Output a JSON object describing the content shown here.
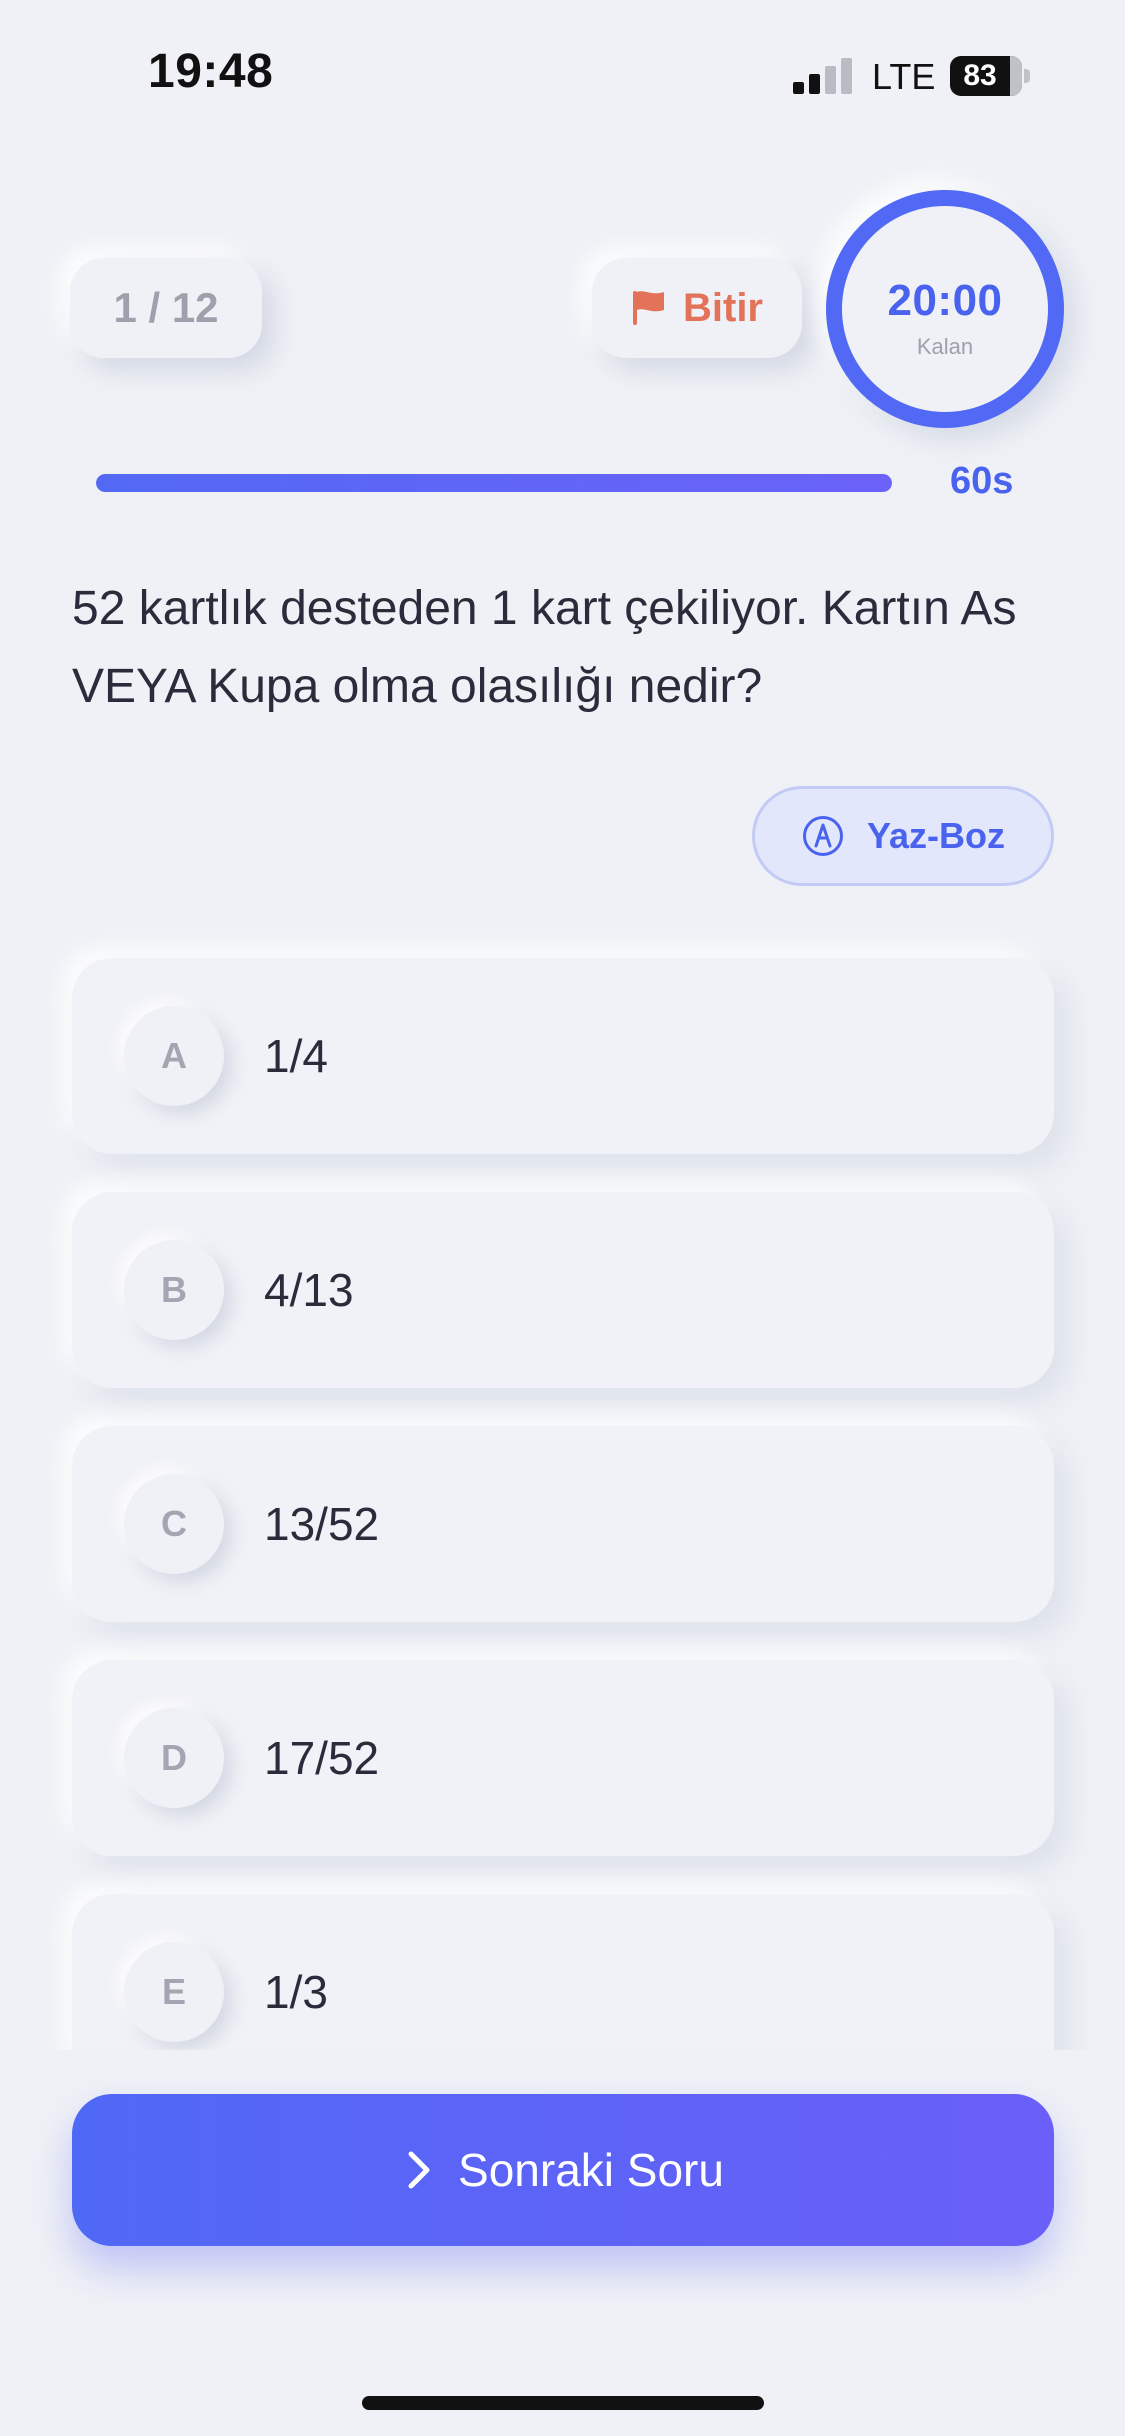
{
  "status_bar": {
    "time": "19:48",
    "network": "LTE",
    "battery_level": "83"
  },
  "header": {
    "question_counter": "1 / 12",
    "finish_label": "Bitir",
    "finish_icon": "flag-icon",
    "timer_value": "20:00",
    "timer_label": "Kalan"
  },
  "progress": {
    "fraction": 1.0,
    "seconds_label": "60s"
  },
  "question": {
    "text": "52 kartlık desteden 1 kart çekiliyor. Kartın As VEYA Kupa olma olasılığı nedir?"
  },
  "tools": {
    "scratch_label": "Yaz-Boz",
    "scratch_icon": "pen-icon"
  },
  "options": [
    {
      "letter": "A",
      "value": "1/4"
    },
    {
      "letter": "B",
      "value": "4/13"
    },
    {
      "letter": "C",
      "value": "13/52"
    },
    {
      "letter": "D",
      "value": "17/52"
    },
    {
      "letter": "E",
      "value": "1/3"
    }
  ],
  "footer": {
    "next_label": "Sonraki Soru",
    "next_icon": "chevron-right-icon"
  },
  "colors": {
    "background": "#eff1f6",
    "accent": "#4a63ee",
    "finish": "#e27358"
  }
}
